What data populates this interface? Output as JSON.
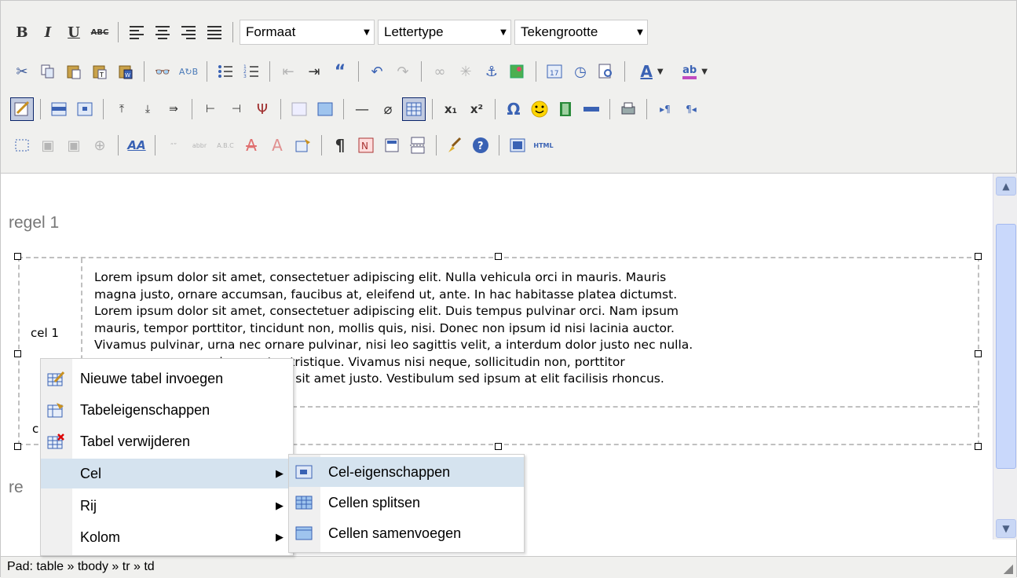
{
  "toolbar": {
    "row1": {
      "bold_label": "B",
      "italic_label": "I",
      "underline_label": "U",
      "strike_label": "ABC",
      "format_select": "Formaat",
      "font_select": "Lettertype",
      "size_select": "Tekengrootte"
    },
    "row2_icons": [
      "cut-icon",
      "copy-icon",
      "paste-icon",
      "paste-text-icon",
      "paste-word-icon",
      "find-icon",
      "replace-icon",
      "bullet-list-icon",
      "numbered-list-icon",
      "outdent-icon",
      "indent-icon",
      "blockquote-icon",
      "undo-icon",
      "redo-icon",
      "link-icon",
      "unlink-icon",
      "anchor-icon",
      "image-icon",
      "insert-date-icon",
      "insert-time-icon",
      "preview-icon",
      "text-color-icon",
      "highlight-color-icon"
    ],
    "text_color_label": "A",
    "highlight_label": "ab",
    "row3": {
      "subscript_label": "x₁",
      "superscript_label": "x²",
      "omega_label": "Ω"
    },
    "row4": {
      "html_label": "HTML",
      "style_label": "AA"
    }
  },
  "content": {
    "paragraph1": "regel 1",
    "paragraph2": "re",
    "cell1_label": "cel 1",
    "cell2_label": "c",
    "lorem_line1": "Lorem ipsum dolor sit amet, consectetuer adipiscing elit. Nulla vehicula orci in mauris. Mauris",
    "lorem_line2": "magna justo, ornare accumsan, faucibus at, eleifend ut, ante. In hac habitasse platea dictumst.",
    "lorem_line3": "Lorem ipsum dolor sit amet, consectetuer adipiscing elit. Duis tempus pulvinar orci. Nam ipsum",
    "lorem_line4": "mauris, tempor porttitor, tincidunt non, mollis quis, nisi. Donec non ipsum id nisi lacinia auctor.",
    "lorem_line5": "Vivamus pulvinar, urna nec ornare pulvinar, nisi leo sagittis velit, a interdum dolor justo nec nulla.",
    "lorem_line6": "enim egestas tristique. Vivamus nisi neque, sollicitudin non, porttitor",
    "lorem_line7": "c, nibh. Donec sit amet justo. Vestibulum sed ipsum at elit facilisis rhoncus."
  },
  "context_menu": {
    "items": [
      {
        "label": "Nieuwe tabel invoegen",
        "icon": "insert-table-icon"
      },
      {
        "label": "Tabeleigenschappen",
        "icon": "table-properties-icon"
      },
      {
        "label": "Tabel verwijderen",
        "icon": "delete-table-icon"
      },
      {
        "label": "Cel",
        "icon": ""
      },
      {
        "label": "Rij",
        "icon": ""
      },
      {
        "label": "Kolom",
        "icon": ""
      }
    ],
    "submenu_arrow": "▶"
  },
  "submenu": {
    "items": [
      {
        "label": "Cel-eigenschappen",
        "icon": "cell-properties-icon"
      },
      {
        "label": "Cellen splitsen",
        "icon": "split-cells-icon"
      },
      {
        "label": "Cellen samenvoegen",
        "icon": "merge-cells-icon"
      }
    ]
  },
  "status": {
    "path": "Pad: table » tbody » tr » td"
  },
  "colors": {
    "toolbar_bg": "#f0f0ee",
    "menu_highlight": "#d5e3ef",
    "scrollbar": "#c9d8fb"
  }
}
